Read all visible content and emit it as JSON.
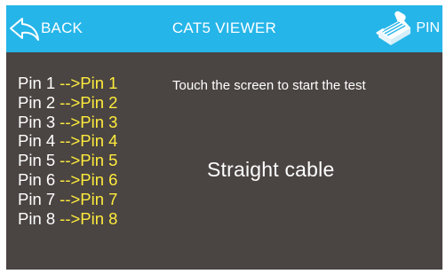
{
  "header": {
    "back_label": "BACK",
    "title": "CAT5 VIEWER",
    "pin_label": "PIN",
    "bar_color": "#25b5e9"
  },
  "icons": {
    "back": "back-arrow-icon",
    "pin": "rj45-plug-icon"
  },
  "pins": [
    {
      "from": "Pin 1",
      "arrow": "-->",
      "to": "Pin 1"
    },
    {
      "from": "Pin 2",
      "arrow": "-->",
      "to": "Pin 2"
    },
    {
      "from": "Pin 3",
      "arrow": "-->",
      "to": "Pin 3"
    },
    {
      "from": "Pin 4",
      "arrow": "-->",
      "to": "Pin 4"
    },
    {
      "from": "Pin 5",
      "arrow": "-->",
      "to": "Pin 5"
    },
    {
      "from": "Pin 6",
      "arrow": "-->",
      "to": "Pin 6"
    },
    {
      "from": "Pin 7",
      "arrow": "-->",
      "to": "Pin 7"
    },
    {
      "from": "Pin 8",
      "arrow": "-->",
      "to": "Pin 8"
    }
  ],
  "instruction": "Touch the screen to start the test",
  "result": "Straight cable",
  "colors": {
    "background": "#4a4442",
    "mapped_pin": "#ffec3d",
    "text": "#ffffff"
  }
}
